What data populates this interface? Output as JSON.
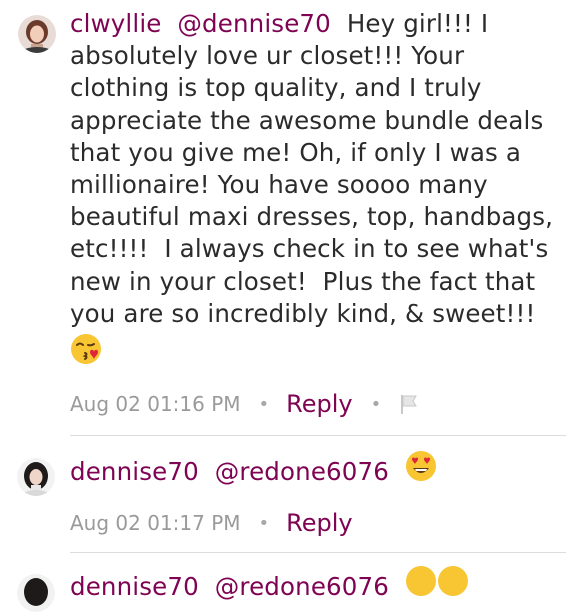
{
  "comments": [
    {
      "username": "clwyllie",
      "mention": "@dennise70",
      "text": "Hey girl!!! I absolutely love ur closet!!! Your clothing is top quality, and I truly appreciate the awesome bundle deals that you give me! Oh, if only I was a millionaire! You have soooo many beautiful maxi dresses, top, handbags, etc!!!!  I always check in to see what's new in your closet!  Plus the fact that you are so incredibly kind, & sweet!!!",
      "emoji": "face-throwing-kiss-emoji",
      "timestamp": "Aug 02 01:16 PM",
      "reply_label": "Reply",
      "flag_icon": "flag-icon"
    },
    {
      "username": "dennise70",
      "mention": "@redone6076",
      "emoji": "heart-eyes-emoji",
      "timestamp": "Aug 02 01:17 PM",
      "reply_label": "Reply"
    },
    {
      "username": "dennise70",
      "mention": "@redone6076",
      "emoji": "smiling-face-emoji"
    }
  ],
  "colors": {
    "username": "#7f0353",
    "reply": "#7f0353",
    "timestamp": "#9a9a9a",
    "text": "#2b2b2b",
    "divider": "#dcdcdc"
  }
}
